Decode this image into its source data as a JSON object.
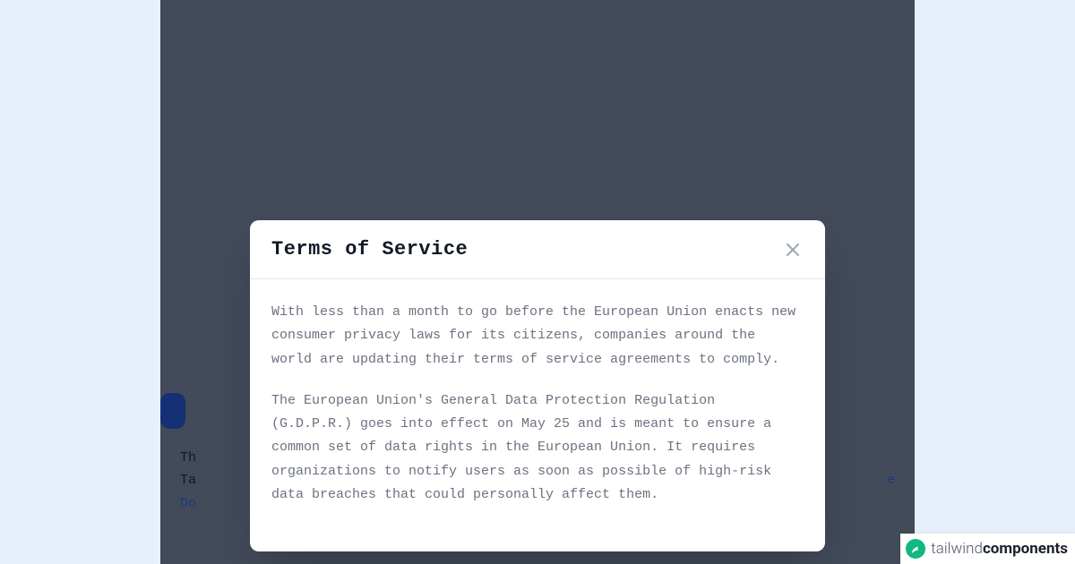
{
  "modal": {
    "title": "Terms of Service",
    "paragraph1": "With less than a month to go before the European Union enacts new consumer privacy laws for its citizens, companies around the world are updating their terms of service agreements to comply.",
    "paragraph2": "The European Union's General Data Protection Regulation (G.D.P.R.) goes into effect on May 25 and is meant to ensure a common set of data rights in the European Union. It requires organizations to notify users as soon as possible of high-risk data breaches that could personally affect them."
  },
  "behind": {
    "line1_prefix": "Th",
    "line2_prefix": "Ta",
    "line2_link_suffix": "e",
    "line3_prefix": "Do"
  },
  "watermark": {
    "light": "tailwind",
    "bold": "components"
  }
}
